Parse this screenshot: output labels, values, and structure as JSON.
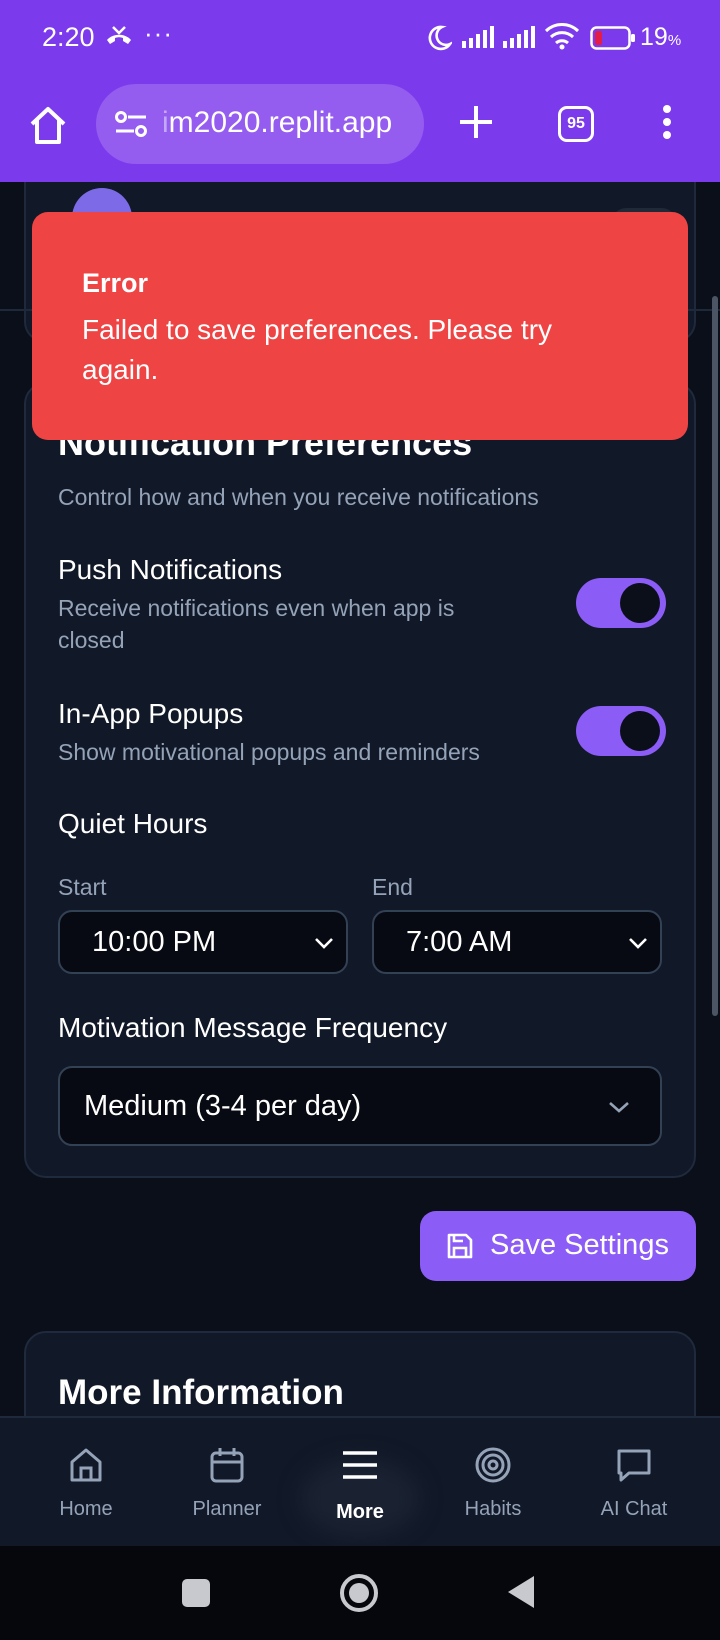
{
  "status_bar": {
    "time": "2:20",
    "overflow": "···",
    "battery_percent": "19",
    "battery_unit": "%"
  },
  "browser": {
    "url_faded": "i",
    "url_text": "m2020.replit.app",
    "tab_count": "95"
  },
  "toast": {
    "title": "Error",
    "message": "Failed to save preferences. Please try again."
  },
  "notification_card": {
    "title": "Notification Preferences",
    "subtitle": "Control how and when you receive notifications",
    "push": {
      "title": "Push Notifications",
      "description": "Receive notifications even when app is closed",
      "enabled": true
    },
    "popups": {
      "title": "In-App Popups",
      "description": "Show motivational popups and reminders",
      "enabled": true
    },
    "quiet_hours": {
      "title": "Quiet Hours",
      "start_label": "Start",
      "start_value": "10:00 PM",
      "end_label": "End",
      "end_value": "7:00 AM"
    },
    "frequency": {
      "title": "Motivation Message Frequency",
      "value": "Medium (3-4 per day)"
    }
  },
  "save_button": {
    "label": "Save Settings"
  },
  "info_card": {
    "title": "More Information"
  },
  "bottom_nav": {
    "items": [
      {
        "label": "Home",
        "icon": "home-icon"
      },
      {
        "label": "Planner",
        "icon": "calendar-icon"
      },
      {
        "label": "More",
        "icon": "menu-icon",
        "active": true
      },
      {
        "label": "Habits",
        "icon": "target-icon"
      },
      {
        "label": "AI Chat",
        "icon": "chat-icon"
      }
    ]
  },
  "colors": {
    "accent": "#8b5cf6",
    "browser_bar": "#7c3aed",
    "error": "#ef4444",
    "background": "#0b0f1a",
    "card": "#111827"
  }
}
